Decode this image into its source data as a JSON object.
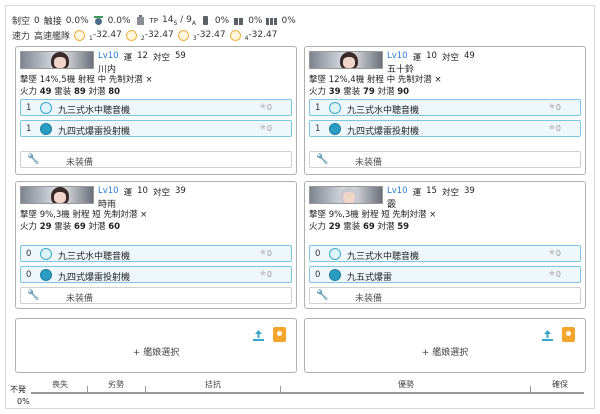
{
  "stats": {
    "row1": {
      "seiku_label": "制空",
      "seiku_value": "0",
      "shokusetsu_label": "触接",
      "shokusetsu_value": "0.0%",
      "ase_value": "0.0%",
      "tp_label": "TP",
      "tp_value": "14",
      "tp_sub1": "S",
      "tp_sep": "/",
      "tp_value2": "9",
      "tp_sub2": "A",
      "drum_value": "0%",
      "daihatsu_value": "0%",
      "cc_value": "0%"
    },
    "row2": {
      "speed_label": "速力",
      "speed_value": "高速艦隊",
      "f1_label": "1",
      "f1_value": "-32.47",
      "f2_label": "2",
      "f2_value": "-32.47",
      "f3_label": "3",
      "f3_value": "-32.47",
      "f4_label": "4",
      "f4_value": "-32.47"
    }
  },
  "ships": [
    {
      "lv": "Lv10",
      "luck_label": "運",
      "luck": "12",
      "aa_label": "対空",
      "aa": "59",
      "name": "川内",
      "line1": "撃墜 14%,5機 射程 中 先制対潜 ×",
      "line2_fp_label": "火力",
      "fp": "49",
      "line2_tp_label": "雷装",
      "tp": "89",
      "line2_as_label": "対潜",
      "as": "80",
      "equips": [
        {
          "count": "1",
          "name": "九三式水中聴音機",
          "star": "★",
          "stars": "0"
        },
        {
          "count": "1",
          "name": "九四式爆雷投射機",
          "star": "★",
          "stars": "0"
        }
      ],
      "empty_label": "未装備"
    },
    {
      "lv": "Lv10",
      "luck_label": "運",
      "luck": "10",
      "aa_label": "対空",
      "aa": "49",
      "name": "五十鈴",
      "line1": "撃墜 12%,4機 射程 中 先制対潜 ×",
      "line2_fp_label": "火力",
      "fp": "39",
      "line2_tp_label": "雷装",
      "tp": "79",
      "line2_as_label": "対潜",
      "as": "90",
      "equips": [
        {
          "count": "1",
          "name": "九三式水中聴音機",
          "star": "★",
          "stars": "0"
        },
        {
          "count": "1",
          "name": "九四式爆雷投射機",
          "star": "★",
          "stars": "0"
        }
      ],
      "empty_label": "未装備"
    },
    {
      "lv": "Lv10",
      "luck_label": "運",
      "luck": "10",
      "aa_label": "対空",
      "aa": "39",
      "name": "時雨",
      "line1": "撃墜 9%,3機 射程 短 先制対潜 ×",
      "line2_fp_label": "火力",
      "fp": "29",
      "line2_tp_label": "雷装",
      "tp": "69",
      "line2_as_label": "対潜",
      "as": "60",
      "equips": [
        {
          "count": "0",
          "name": "九三式水中聴音機",
          "star": "★",
          "stars": "0"
        },
        {
          "count": "0",
          "name": "九四式爆雷投射機",
          "star": "★",
          "stars": "0"
        }
      ],
      "empty_label": "未装備"
    },
    {
      "lv": "Lv10",
      "luck_label": "運",
      "luck": "15",
      "aa_label": "対空",
      "aa": "39",
      "name": "霰",
      "line1": "撃墜 9%,3機 射程 短 先制対潜 ×",
      "line2_fp_label": "火力",
      "fp": "29",
      "line2_tp_label": "雷装",
      "tp": "69",
      "line2_as_label": "対潜",
      "as": "59",
      "equips": [
        {
          "count": "0",
          "name": "九三式水中聴音機",
          "star": "★",
          "stars": "0"
        },
        {
          "count": "0",
          "name": "九五式爆雷",
          "star": "★",
          "stars": "0"
        }
      ],
      "empty_label": "未装備"
    }
  ],
  "add_slots": [
    {
      "label": "+ 艦娘選択"
    },
    {
      "label": "+ 艦娘選択"
    }
  ],
  "bottom_bar": {
    "left_top": "不発",
    "left_bottom": "0%",
    "segments": [
      "喪失",
      "劣勢",
      "拮抗",
      "優勢",
      "確保"
    ]
  },
  "colors": {
    "accent": "#2a7bd6",
    "equip_border": "#7cc6e0",
    "lock": "#f3a52c"
  }
}
